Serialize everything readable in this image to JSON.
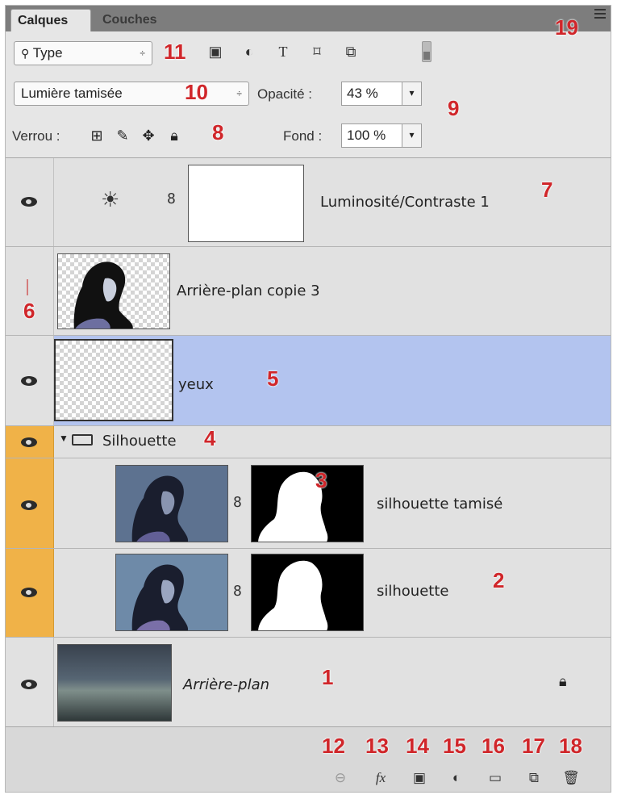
{
  "tabs": {
    "active": "Calques",
    "inactive": "Couches"
  },
  "filter": {
    "kind_label": "Type",
    "arrows": "÷"
  },
  "blend": {
    "mode": "Lumière tamisée",
    "arrows": "÷"
  },
  "opacity": {
    "label": "Opacité :",
    "value": "43 %"
  },
  "lock": {
    "label": "Verrou :"
  },
  "fill": {
    "label": "Fond :",
    "value": "100 %"
  },
  "stepper_glyph": "▾",
  "layers": [
    {
      "name": "Luminosité/Contraste 1"
    },
    {
      "name": "Arrière-plan copie 3"
    },
    {
      "name": "yeux"
    },
    {
      "name": "Silhouette"
    },
    {
      "name": "silhouette tamisé"
    },
    {
      "name": "silhouette"
    },
    {
      "name": "Arrière-plan"
    }
  ],
  "callouts": [
    "1",
    "2",
    "3",
    "4",
    "5",
    "6",
    "7",
    "8",
    "9",
    "10",
    "11",
    "12",
    "13",
    "14",
    "15",
    "16",
    "17",
    "18",
    "19"
  ],
  "colors": {
    "selected_row": "#b3c4ef",
    "group_eye_column": "#f0b248",
    "callout": "#d0262a"
  },
  "icons": {
    "filter_icons": [
      "image-filter-icon",
      "adjustment-filter-icon",
      "text-filter-icon",
      "shape-filter-icon",
      "smart-object-filter-icon"
    ],
    "lock_icons": [
      "lock-transparency-icon",
      "lock-pixels-icon",
      "lock-position-icon",
      "lock-all-icon"
    ],
    "footer_icons": [
      "link-layers-icon",
      "fx-icon",
      "add-mask-icon",
      "new-adjustment-icon",
      "new-group-icon",
      "new-layer-icon",
      "trash-icon"
    ]
  }
}
